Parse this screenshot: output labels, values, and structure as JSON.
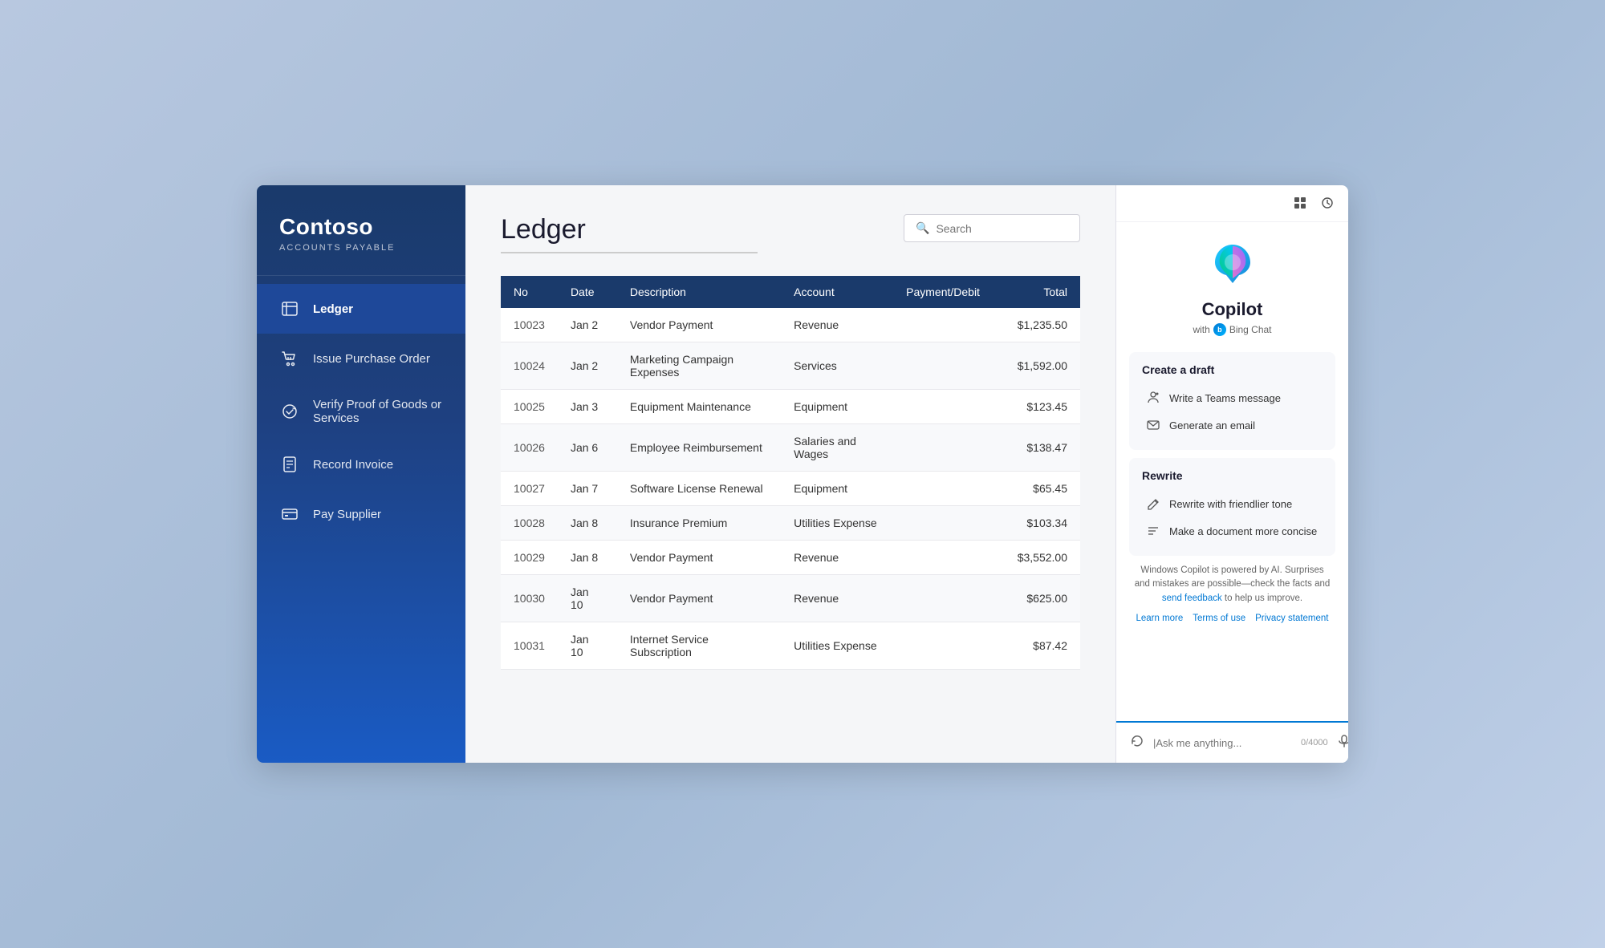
{
  "sidebar": {
    "company": "Contoso",
    "subtitle": "ACCOUNTS PAYABLE",
    "nav_items": [
      {
        "id": "ledger",
        "label": "Ledger",
        "active": true,
        "icon": "ledger"
      },
      {
        "id": "purchase-order",
        "label": "Issue Purchase Order",
        "active": false,
        "icon": "cart"
      },
      {
        "id": "verify-goods",
        "label": "Verify Proof of Goods or Services",
        "active": false,
        "icon": "verify"
      },
      {
        "id": "record-invoice",
        "label": "Record Invoice",
        "active": false,
        "icon": "invoice"
      },
      {
        "id": "pay-supplier",
        "label": "Pay Supplier",
        "active": false,
        "icon": "pay"
      }
    ]
  },
  "main": {
    "title": "Ledger",
    "search_placeholder": "Search",
    "table": {
      "headers": [
        "No",
        "Date",
        "Description",
        "Account",
        "Payment/Debit",
        "Total"
      ],
      "rows": [
        {
          "no": "10023",
          "date": "Jan 2",
          "description": "Vendor Payment",
          "account": "Revenue",
          "payment_debit": "",
          "total": "$1,235.50"
        },
        {
          "no": "10024",
          "date": "Jan 2",
          "description": "Marketing Campaign Expenses",
          "account": "Services",
          "payment_debit": "",
          "total": "$1,592.00"
        },
        {
          "no": "10025",
          "date": "Jan 3",
          "description": "Equipment Maintenance",
          "account": "Equipment",
          "payment_debit": "",
          "total": "$123.45"
        },
        {
          "no": "10026",
          "date": "Jan 6",
          "description": "Employee Reimbursement",
          "account": "Salaries and Wages",
          "payment_debit": "",
          "total": "$138.47"
        },
        {
          "no": "10027",
          "date": "Jan 7",
          "description": "Software License Renewal",
          "account": "Equipment",
          "payment_debit": "",
          "total": "$65.45"
        },
        {
          "no": "10028",
          "date": "Jan 8",
          "description": "Insurance Premium",
          "account": "Utilities Expense",
          "payment_debit": "",
          "total": "$103.34"
        },
        {
          "no": "10029",
          "date": "Jan 8",
          "description": "Vendor Payment",
          "account": "Revenue",
          "payment_debit": "",
          "total": "$3,552.00"
        },
        {
          "no": "10030",
          "date": "Jan 10",
          "description": "Vendor Payment",
          "account": "Revenue",
          "payment_debit": "",
          "total": "$625.00"
        },
        {
          "no": "10031",
          "date": "Jan 10",
          "description": "Internet Service Subscription",
          "account": "Utilities Expense",
          "payment_debit": "",
          "total": "$87.42"
        }
      ]
    }
  },
  "copilot": {
    "name": "Copilot",
    "subtitle": "with",
    "bing_label": "Bing Chat",
    "create_draft_title": "Create a draft",
    "actions_draft": [
      {
        "id": "teams-msg",
        "label": "Write a Teams message",
        "icon": "teams"
      },
      {
        "id": "email",
        "label": "Generate an email",
        "icon": "email"
      }
    ],
    "rewrite_title": "Rewrite",
    "actions_rewrite": [
      {
        "id": "friendly",
        "label": "Rewrite with friendlier tone",
        "icon": "pencil"
      },
      {
        "id": "concise",
        "label": "Make a document more concise",
        "icon": "lines"
      }
    ],
    "disclaimer": "Windows Copilot is powered by AI. Surprises and mistakes are possible—check the facts and",
    "feedback_link": "send feedback",
    "disclaimer_end": "to help us improve.",
    "learn_more": "Learn more",
    "terms_of_use": "Terms of use",
    "privacy_statement": "Privacy statement",
    "chat_placeholder": "|Ask me anything...",
    "char_count": "0/4000"
  }
}
